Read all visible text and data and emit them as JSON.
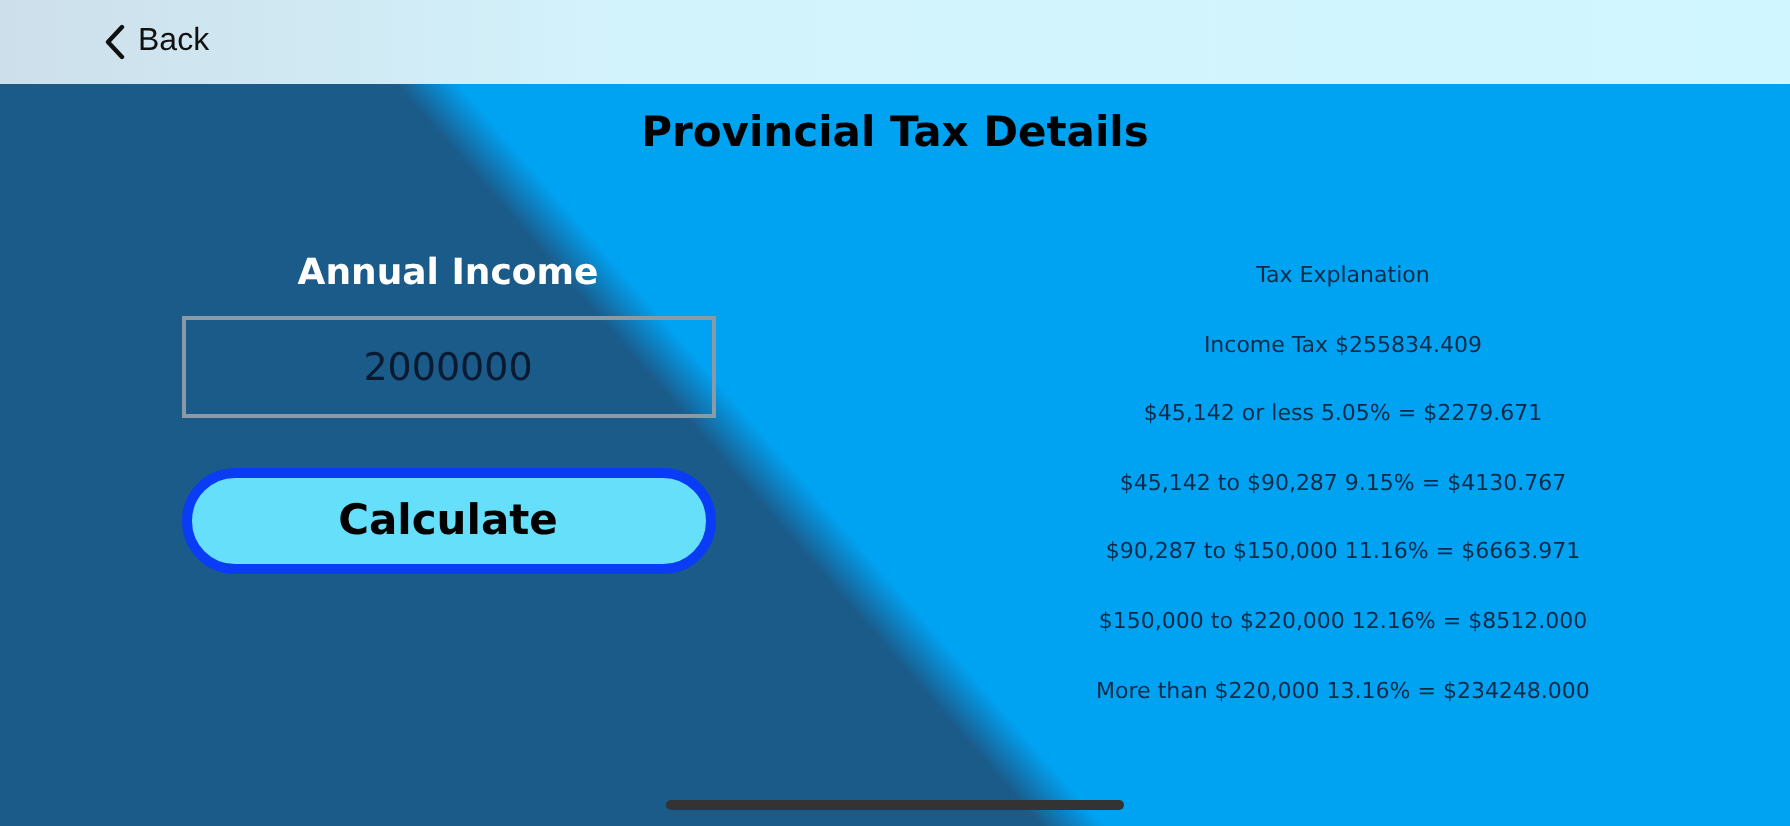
{
  "nav": {
    "back_label": "Back"
  },
  "title": "Provincial Tax Details",
  "income": {
    "label": "Annual Income",
    "value": "2000000"
  },
  "calculate_button": "Calculate",
  "explanation": [
    "Tax Explanation",
    "Income Tax $255834.409",
    "$45,142 or less 5.05% = $2279.671",
    "$45,142 to $90,287 9.15% = $4130.767",
    "$90,287 to $150,000 11.16% = $6663.971",
    "$150,000 to $220,000 12.16% = $8512.000",
    "More than $220,000 13.16% = $234248.000"
  ]
}
